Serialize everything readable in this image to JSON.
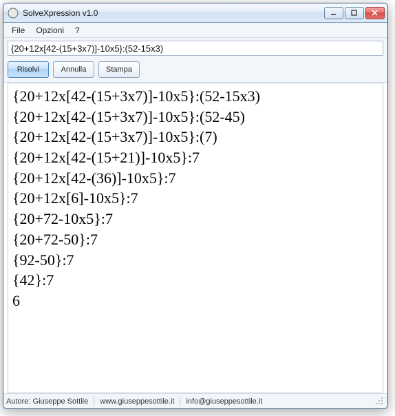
{
  "window": {
    "title": "SolveXpression v1.0"
  },
  "menu": {
    "file": "File",
    "options": "Opzioni",
    "help": "?"
  },
  "input": {
    "expression": "{20+12x[42-(15+3x7)]-10x5}:(52-15x3)"
  },
  "buttons": {
    "solve": "Risolvi",
    "cancel": "Annulla",
    "print": "Stampa"
  },
  "steps": [
    "{20+12x[42-(15+3x7)]-10x5}:(52-15x3)",
    "{20+12x[42-(15+3x7)]-10x5}:(52-45)",
    "{20+12x[42-(15+3x7)]-10x5}:(7)",
    "{20+12x[42-(15+21)]-10x5}:7",
    "{20+12x[42-(36)]-10x5}:7",
    "{20+12x[6]-10x5}:7",
    "{20+72-10x5}:7",
    "{20+72-50}:7",
    "{92-50}:7",
    "{42}:7",
    "6"
  ],
  "status": {
    "author": "Autore: Giuseppe Sottile",
    "site": "www.giuseppesottile.it",
    "email": "info@giuseppesottile.it"
  }
}
